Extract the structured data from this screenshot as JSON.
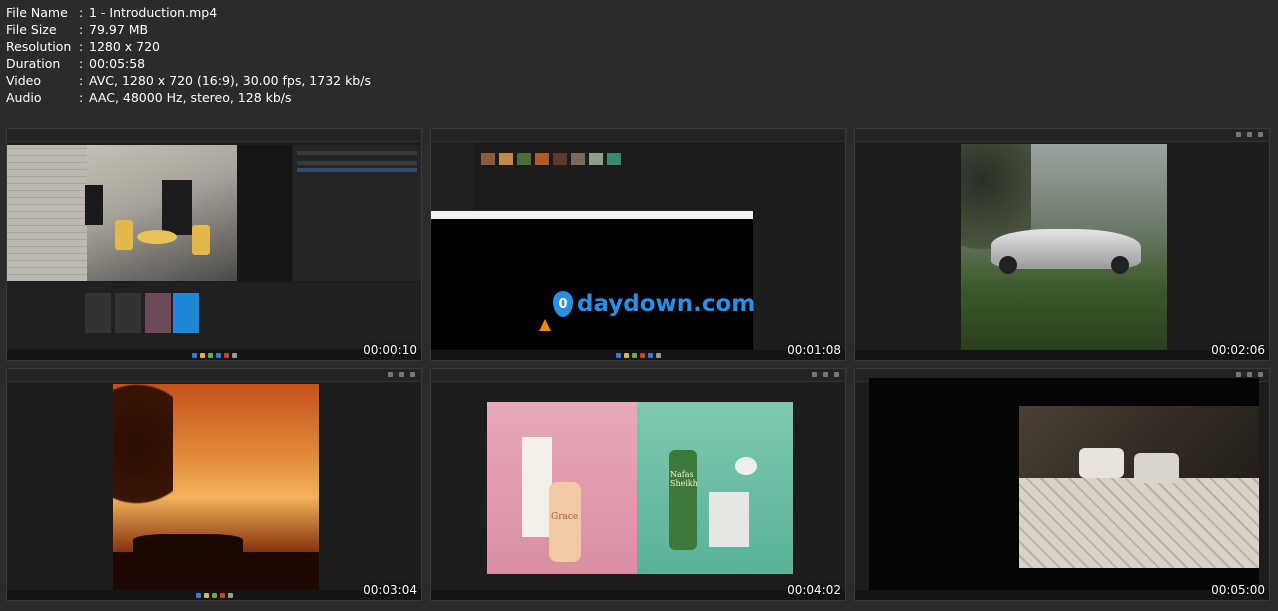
{
  "file_info": [
    {
      "key": "File Name",
      "value": "1 - Introduction.mp4"
    },
    {
      "key": "File Size",
      "value": "79.97 MB"
    },
    {
      "key": "Resolution",
      "value": "1280 x 720"
    },
    {
      "key": "Duration",
      "value": "00:05:58"
    },
    {
      "key": "Video",
      "value": "AVC, 1280 x 720 (16:9), 30.00 fps, 1732 kb/s"
    },
    {
      "key": "Audio",
      "value": "AAC, 48000 Hz, stereo, 128 kb/s"
    }
  ],
  "colon": ":",
  "thumbnails": [
    {
      "timestamp": "00:00:10",
      "scene": "3d-editor-room"
    },
    {
      "timestamp": "00:01:08",
      "scene": "file-explorer-watermark"
    },
    {
      "timestamp": "00:02:06",
      "scene": "sports-car-forest"
    },
    {
      "timestamp": "00:03:04",
      "scene": "sunset-car"
    },
    {
      "timestamp": "00:04:02",
      "scene": "cosmetics-products"
    },
    {
      "timestamp": "00:05:00",
      "scene": "bedroom"
    }
  ],
  "watermark": {
    "text": "daydown.com",
    "glyph": "0"
  },
  "product_labels": {
    "left": "Grace",
    "right": "Nafas Sheikh"
  },
  "colors": {
    "background": "#2b2b2b",
    "accent_blue": "#2b8fe6"
  }
}
